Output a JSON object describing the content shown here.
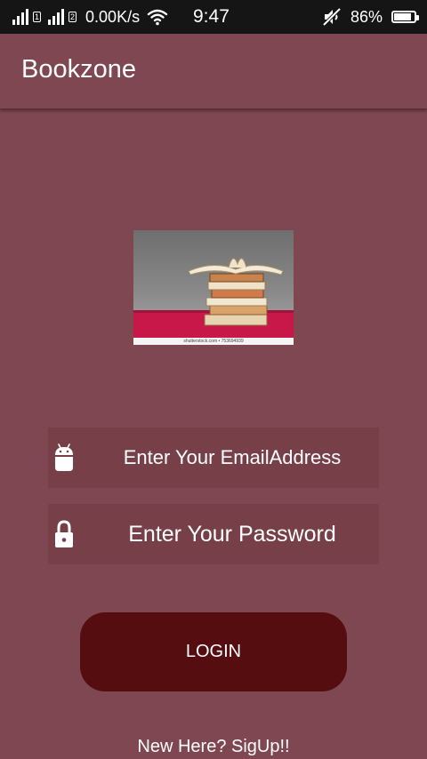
{
  "status_bar": {
    "sim1_label": "1",
    "sim2_label": "2",
    "network_speed": "0.00K/s",
    "time": "9:47",
    "battery_percent": "86%",
    "battery_level": 0.86,
    "icons": [
      "signal-icon",
      "signal-icon",
      "wifi-icon",
      "mute-icon",
      "battery-icon"
    ]
  },
  "app_bar": {
    "title": "Bookzone"
  },
  "hero": {
    "caption": "shutterstock.com • 753694939",
    "icon": "book-stack-image"
  },
  "login_form": {
    "email": {
      "placeholder": "Enter Your EmailAddress",
      "icon": "android-icon"
    },
    "password": {
      "placeholder": "Enter Your Password",
      "icon": "lock-icon"
    },
    "login_label": "LOGIN",
    "signup_text": "New Here? SigUp!!"
  },
  "colors": {
    "background": "#7f4751",
    "status_bar": "#151515",
    "field_background": "#774049",
    "login_button": "#550d10",
    "text": "#ffffff"
  }
}
